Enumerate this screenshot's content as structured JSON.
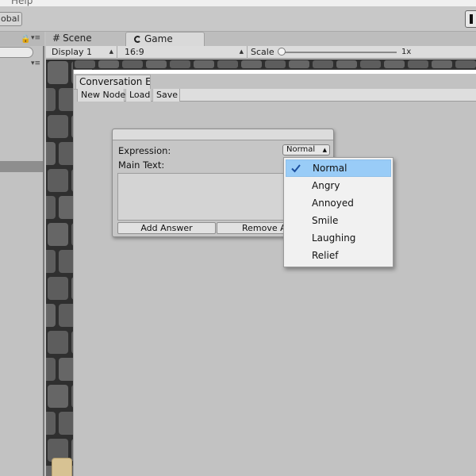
{
  "os_menu": {
    "help": "Help"
  },
  "main_toolbar": {
    "global_toggle": "obal"
  },
  "view_tabs": {
    "scene": "Scene",
    "game": "Game"
  },
  "game_toolbar": {
    "display": "Display 1",
    "aspect": "16:9",
    "scale_label": "Scale",
    "scale_value": "1x",
    "scale_level": 0.0
  },
  "editor": {
    "tab_title": "Conversation E",
    "toolbar": {
      "new_node": "New Node",
      "load": "Load",
      "save": "Save"
    }
  },
  "node": {
    "expression_label": "Expression:",
    "expression_value": "Normal",
    "main_text_label": "Main Text:",
    "main_text_value": "",
    "add_answer": "Add Answer",
    "remove_answer": "Remove A"
  },
  "expression_menu": {
    "selected_index": 0,
    "options": [
      "Normal",
      "Angry",
      "Annoyed",
      "Smile",
      "Laughing",
      "Relief"
    ]
  },
  "colors": {
    "menu_highlight": "#99ccf7",
    "check_mark": "#1a4fa0",
    "stone": "#5d5d5d",
    "mortar": "#2f2f2f"
  }
}
